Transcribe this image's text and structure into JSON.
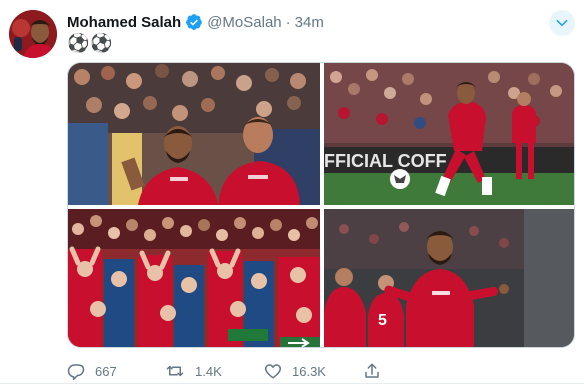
{
  "tweet": {
    "author_name": "Mohamed Salah",
    "handle": "@MoSalah",
    "separator": "·",
    "time": "34m",
    "text": "⚽⚽",
    "images": [
      {
        "sign_text": ""
      },
      {
        "sign_text": "FFICIAL COFF"
      },
      {
        "sign_text": ""
      },
      {
        "sign_text": ""
      }
    ],
    "actions": {
      "replies": "667",
      "retweets": "1.4K",
      "likes": "16.3K"
    }
  },
  "colors": {
    "liverpool_red": "#c8102e",
    "verified_blue": "#1da1f2",
    "secondary_text": "#657786"
  }
}
